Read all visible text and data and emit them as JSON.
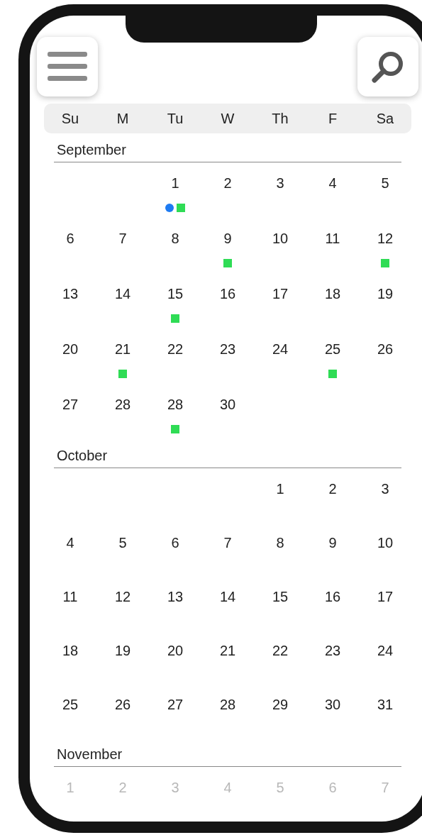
{
  "weekdays": [
    "Su",
    "M",
    "Tu",
    "W",
    "Th",
    "F",
    "Sa"
  ],
  "months": [
    {
      "name": "September",
      "dimmed": false,
      "weeks": [
        [
          {
            "kind": "blank"
          },
          {
            "kind": "blank"
          },
          {
            "kind": "day",
            "label": "1",
            "markers": [
              {
                "kind": "dot",
                "color": "#1e7bf2"
              },
              {
                "kind": "square",
                "color": "#2fdc55"
              }
            ]
          },
          {
            "kind": "day",
            "label": "2"
          },
          {
            "kind": "day",
            "label": "3"
          },
          {
            "kind": "day",
            "label": "4"
          },
          {
            "kind": "day",
            "label": "5"
          }
        ],
        [
          {
            "kind": "day",
            "label": "6"
          },
          {
            "kind": "day",
            "label": "7"
          },
          {
            "kind": "day",
            "label": "8"
          },
          {
            "kind": "day",
            "label": "9",
            "markers": [
              {
                "kind": "square",
                "color": "#2fdc55"
              }
            ]
          },
          {
            "kind": "day",
            "label": "10"
          },
          {
            "kind": "day",
            "label": "11"
          },
          {
            "kind": "day",
            "label": "12",
            "markers": [
              {
                "kind": "square",
                "color": "#2fdc55"
              }
            ]
          }
        ],
        [
          {
            "kind": "day",
            "label": "13"
          },
          {
            "kind": "day",
            "label": "14"
          },
          {
            "kind": "day",
            "label": "15",
            "markers": [
              {
                "kind": "square",
                "color": "#2fdc55"
              }
            ]
          },
          {
            "kind": "day",
            "label": "16"
          },
          {
            "kind": "day",
            "label": "17"
          },
          {
            "kind": "day",
            "label": "18"
          },
          {
            "kind": "day",
            "label": "19"
          }
        ],
        [
          {
            "kind": "day",
            "label": "20"
          },
          {
            "kind": "day",
            "label": "21",
            "markers": [
              {
                "kind": "square",
                "color": "#2fdc55"
              }
            ]
          },
          {
            "kind": "day",
            "label": "22"
          },
          {
            "kind": "day",
            "label": "23"
          },
          {
            "kind": "day",
            "label": "24"
          },
          {
            "kind": "day",
            "label": "25",
            "markers": [
              {
                "kind": "square",
                "color": "#2fdc55"
              }
            ]
          },
          {
            "kind": "day",
            "label": "26"
          }
        ],
        [
          {
            "kind": "day",
            "label": "27"
          },
          {
            "kind": "day",
            "label": "28"
          },
          {
            "kind": "day",
            "label": "28",
            "markers": [
              {
                "kind": "square",
                "color": "#2fdc55"
              }
            ]
          },
          {
            "kind": "day",
            "label": "30"
          },
          {
            "kind": "blank"
          },
          {
            "kind": "blank"
          },
          {
            "kind": "blank"
          }
        ]
      ]
    },
    {
      "name": "October",
      "dimmed": false,
      "weeks": [
        [
          {
            "kind": "blank"
          },
          {
            "kind": "blank"
          },
          {
            "kind": "blank"
          },
          {
            "kind": "blank"
          },
          {
            "kind": "day",
            "label": "1"
          },
          {
            "kind": "day",
            "label": "2"
          },
          {
            "kind": "day",
            "label": "3"
          }
        ],
        [
          {
            "kind": "day",
            "label": "4"
          },
          {
            "kind": "day",
            "label": "5"
          },
          {
            "kind": "day",
            "label": "6"
          },
          {
            "kind": "day",
            "label": "7"
          },
          {
            "kind": "day",
            "label": "8"
          },
          {
            "kind": "day",
            "label": "9"
          },
          {
            "kind": "day",
            "label": "10"
          }
        ],
        [
          {
            "kind": "day",
            "label": "11"
          },
          {
            "kind": "day",
            "label": "12"
          },
          {
            "kind": "day",
            "label": "13"
          },
          {
            "kind": "day",
            "label": "14"
          },
          {
            "kind": "day",
            "label": "15"
          },
          {
            "kind": "day",
            "label": "16"
          },
          {
            "kind": "day",
            "label": "17"
          }
        ],
        [
          {
            "kind": "day",
            "label": "18"
          },
          {
            "kind": "day",
            "label": "19"
          },
          {
            "kind": "day",
            "label": "20"
          },
          {
            "kind": "day",
            "label": "21"
          },
          {
            "kind": "day",
            "label": "22"
          },
          {
            "kind": "day",
            "label": "23"
          },
          {
            "kind": "day",
            "label": "24"
          }
        ],
        [
          {
            "kind": "day",
            "label": "25"
          },
          {
            "kind": "day",
            "label": "26"
          },
          {
            "kind": "day",
            "label": "27"
          },
          {
            "kind": "day",
            "label": "28"
          },
          {
            "kind": "day",
            "label": "29"
          },
          {
            "kind": "day",
            "label": "30"
          },
          {
            "kind": "day",
            "label": "31"
          }
        ]
      ]
    },
    {
      "name": "November",
      "dimmed": true,
      "weeks": [
        [
          {
            "kind": "day",
            "label": "1"
          },
          {
            "kind": "day",
            "label": "2"
          },
          {
            "kind": "day",
            "label": "3"
          },
          {
            "kind": "day",
            "label": "4"
          },
          {
            "kind": "day",
            "label": "5"
          },
          {
            "kind": "day",
            "label": "6"
          },
          {
            "kind": "day",
            "label": "7"
          }
        ]
      ]
    }
  ]
}
